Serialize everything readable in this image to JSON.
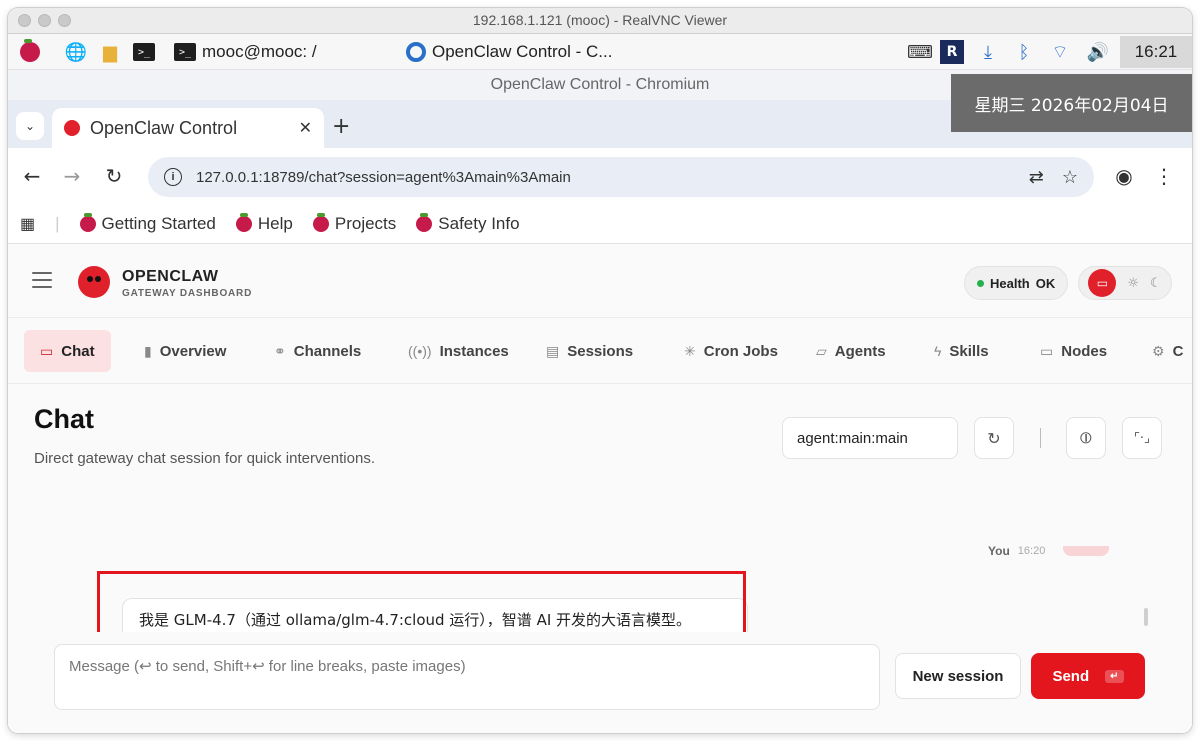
{
  "window": {
    "title": "192.168.1.121 (mooc) - RealVNC Viewer"
  },
  "taskbar": {
    "terminal_task": "mooc@mooc: /",
    "browser_task": "OpenClaw Control - C...",
    "clock": "16:21",
    "date_tooltip": "星期三 2026年02月04日"
  },
  "browser": {
    "window_title": "OpenClaw Control - Chromium",
    "tab_title": "OpenClaw Control",
    "url": "127.0.0.1:18789/chat?session=agent%3Amain%3Amain",
    "bookmarks": [
      "Getting Started",
      "Help",
      "Projects",
      "Safety Info"
    ]
  },
  "app": {
    "brand_name": "OPENCLAW",
    "brand_sub": "GATEWAY DASHBOARD",
    "health_label": "Health",
    "health_status": "OK",
    "nav": [
      "Chat",
      "Overview",
      "Channels",
      "Instances",
      "Sessions",
      "Cron Jobs",
      "Agents",
      "Skills",
      "Nodes",
      "C"
    ],
    "page_title": "Chat",
    "page_subtitle": "Direct gateway chat session for quick interventions.",
    "session_key": "agent:main:main",
    "user_label": "You",
    "user_time": "16:20",
    "assistant_message": "我是 GLM-4.7（通过 ollama/glm-4.7:cloud 运行），智谱 AI 开发的大语言模型。",
    "input_placeholder": "Message (↩ to send, Shift+↩ for line breaks, paste images)",
    "new_session_label": "New session",
    "send_label": "Send",
    "send_kbd": "↵"
  },
  "colors": {
    "accent": "#e3161e",
    "active_tab_bg": "#fbe1e2",
    "health_dot": "#22b14c"
  }
}
